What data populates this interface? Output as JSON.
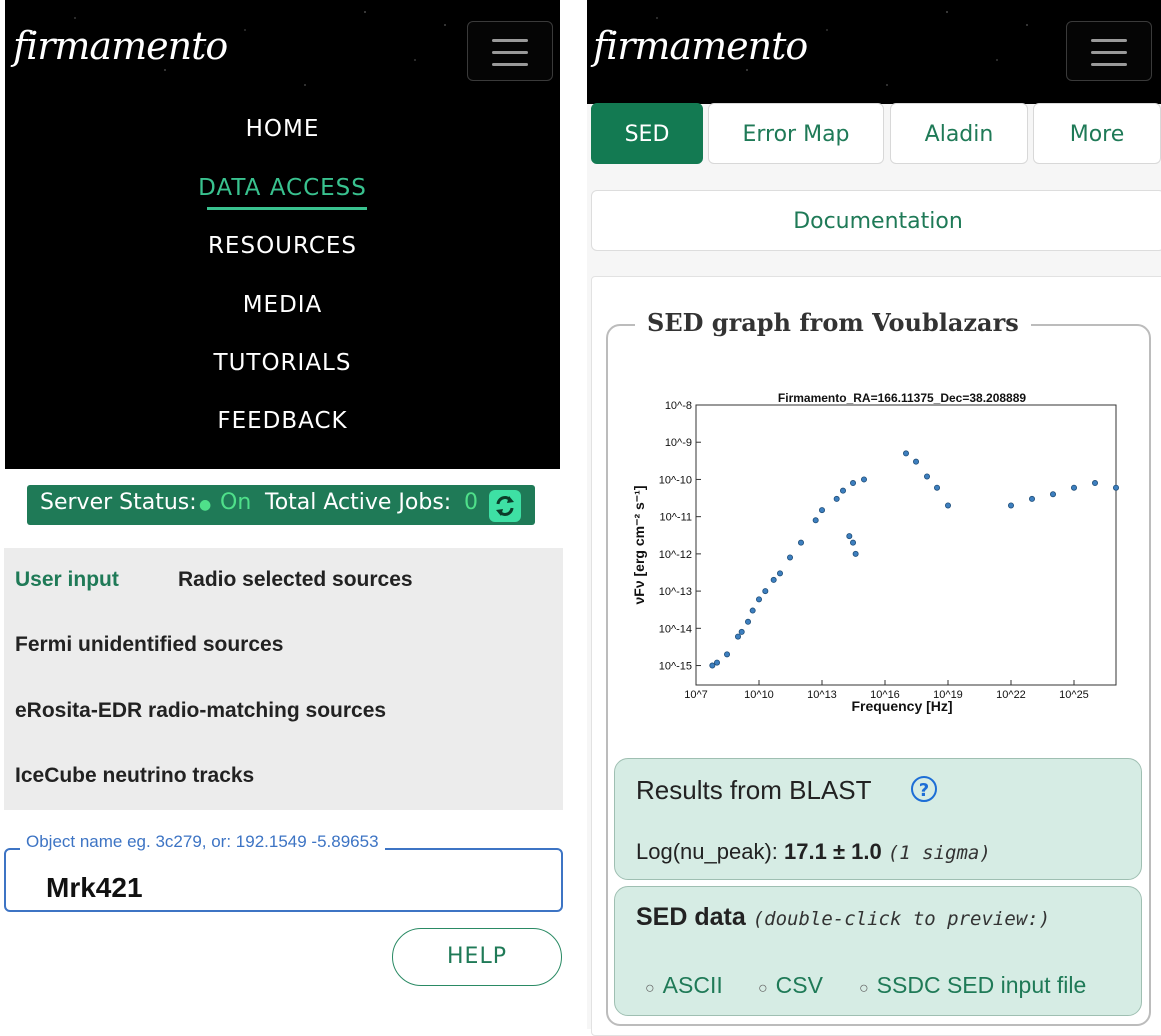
{
  "left": {
    "brand": "firmamento",
    "menu": [
      "HOME",
      "DATA ACCESS",
      "RESOURCES",
      "MEDIA",
      "TUTORIALS",
      "FEEDBACK"
    ],
    "active_menu": "DATA ACCESS",
    "status": {
      "server_label": "Server Status:",
      "server_value": "On",
      "jobs_label": "Total Active Jobs:",
      "jobs_value": "0"
    },
    "source_tabs": [
      "User input",
      "Radio selected sources",
      "Fermi unidentified sources",
      "eRosita-EDR radio-matching sources",
      "IceCube neutrino tracks"
    ],
    "active_source_tab": "User input",
    "object_field": {
      "legend": "Object name eg. 3c279, or: 192.1549 -5.89653",
      "value": "Mrk421"
    },
    "help_button": "HELP"
  },
  "right": {
    "brand": "firmamento",
    "tabs": [
      "SED",
      "Error Map",
      "Aladin",
      "More"
    ],
    "active_tab": "SED",
    "documentation": "Documentation",
    "graph_title": "SED graph from Voublazars",
    "blast": {
      "title": "Results from BLAST",
      "label": "Log(nu_peak):",
      "value": "17.1 ± 1.0",
      "note": "(1 sigma)"
    },
    "sed_data": {
      "title": "SED data",
      "hint": "(double-click to preview:)",
      "links": [
        "ASCII",
        "CSV",
        "SSDC SED input file"
      ]
    }
  },
  "chart_data": {
    "type": "scatter",
    "title": "Firmamento_RA=166.11375_Dec=38.208889",
    "xlabel": "Frequency [Hz]",
    "ylabel": "νFν [erg cm⁻² s⁻¹]",
    "xscale": "log",
    "yscale": "log",
    "xlim": [
      10000000.0,
      1e+27
    ],
    "ylim": [
      3e-16,
      1e-08
    ],
    "xticks": [
      "10^7",
      "10^10",
      "10^13",
      "10^16",
      "10^19",
      "10^22",
      "10^25"
    ],
    "yticks": [
      "10^-8",
      "10^-9",
      "10^-10",
      "10^-11",
      "10^-12",
      "10^-13",
      "10^-14",
      "10^-15"
    ],
    "colors": {
      "points": "#1f4e79",
      "point_fill": "#3d7fbf",
      "highlight": "#d94848",
      "upper_limits": "#999999"
    },
    "series": [
      {
        "name": "",
        "points": [
          [
            60000000.0,
            1e-15
          ],
          [
            100000000.0,
            1.2e-15
          ],
          [
            300000000.0,
            2e-15
          ],
          [
            1000000000.0,
            6e-15
          ],
          [
            1500000000.0,
            8e-15
          ],
          [
            3000000000.0,
            1.5e-14
          ],
          [
            5000000000.0,
            3e-14
          ],
          [
            10000000000.0,
            6e-14
          ],
          [
            20000000000.0,
            1e-13
          ],
          [
            50000000000.0,
            2e-13
          ],
          [
            100000000000.0,
            3e-13
          ],
          [
            300000000000.0,
            8e-13
          ],
          [
            1000000000000.0,
            2e-12
          ],
          [
            5000000000000.0,
            8e-12
          ],
          [
            10000000000000.0,
            1.5e-11
          ],
          [
            50000000000000.0,
            3e-11
          ],
          [
            100000000000000.0,
            5e-11
          ],
          [
            300000000000000.0,
            8e-11
          ],
          [
            1000000000000000.0,
            1e-10
          ],
          [
            200000000000000.0,
            3e-12
          ],
          [
            400000000000000.0,
            1e-12
          ],
          [
            300000000000000.0,
            2e-12
          ],
          [
            1e+17,
            5e-10
          ],
          [
            3e+17,
            3e-10
          ],
          [
            1e+18,
            1.2e-10
          ],
          [
            3e+18,
            6e-11
          ],
          [
            1e+19,
            2e-11
          ],
          [
            1e+22,
            2e-11
          ],
          [
            1e+23,
            3e-11
          ],
          [
            1e+24,
            4e-11
          ],
          [
            1e+25,
            6e-11
          ],
          [
            1e+26,
            8e-11
          ],
          [
            1e+27,
            6e-11
          ]
        ]
      }
    ]
  }
}
